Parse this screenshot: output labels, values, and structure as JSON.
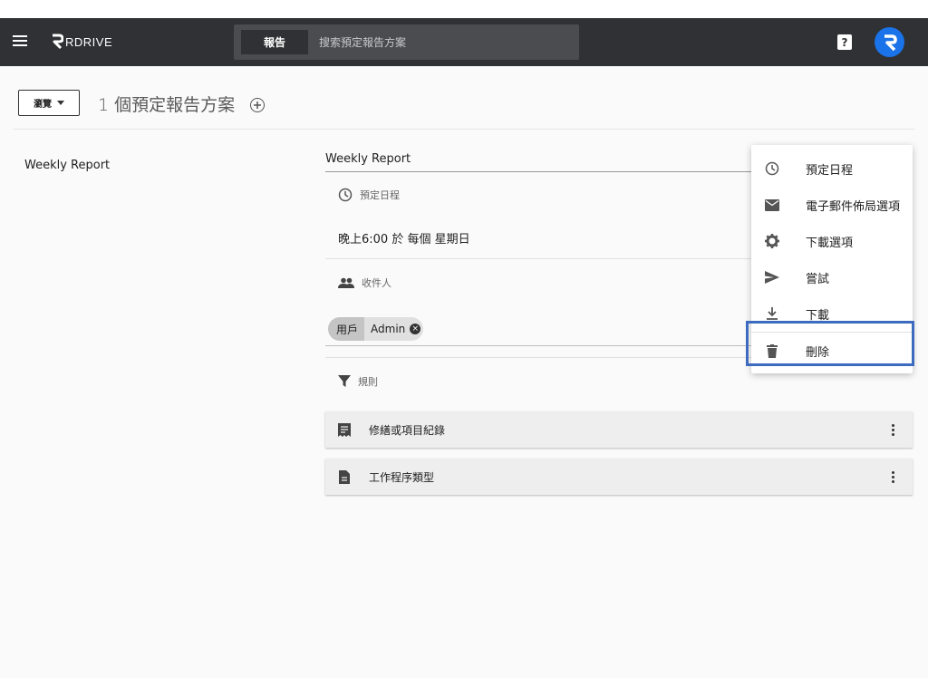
{
  "app": {
    "logo_text": "RDRIVE"
  },
  "search": {
    "tab_label": "報告",
    "placeholder": "搜索預定報告方案"
  },
  "header": {
    "help_label": "?"
  },
  "toolbar": {
    "browse_label": "瀏覽",
    "title": "1 個預定報告方案"
  },
  "list": {
    "items": [
      {
        "name": "Weekly Report"
      }
    ]
  },
  "detail": {
    "name": "Weekly Report",
    "schedule_heading": "預定日程",
    "schedule_text": "晚上6:00 於 每個 星期日",
    "recipients_heading": "收件人",
    "recipient": {
      "type": "用戶",
      "name": "Admin"
    },
    "rules_heading": "規則",
    "rules": [
      {
        "label": "修繕或項目紀錄"
      },
      {
        "label": "工作程序類型"
      }
    ]
  },
  "menu": {
    "items": [
      {
        "label": "預定日程",
        "icon": "clock-icon"
      },
      {
        "label": "電子郵件佈局選項",
        "icon": "mail-icon"
      },
      {
        "label": "下載選項",
        "icon": "gear-icon"
      },
      {
        "label": "嘗試",
        "icon": "send-icon"
      },
      {
        "label": "下載",
        "icon": "download-icon"
      },
      {
        "label": "刪除",
        "icon": "trash-icon"
      }
    ]
  },
  "colors": {
    "topbar": "#2f3134",
    "highlight": "#3d6bc0",
    "avatar": "#1a73e8"
  }
}
